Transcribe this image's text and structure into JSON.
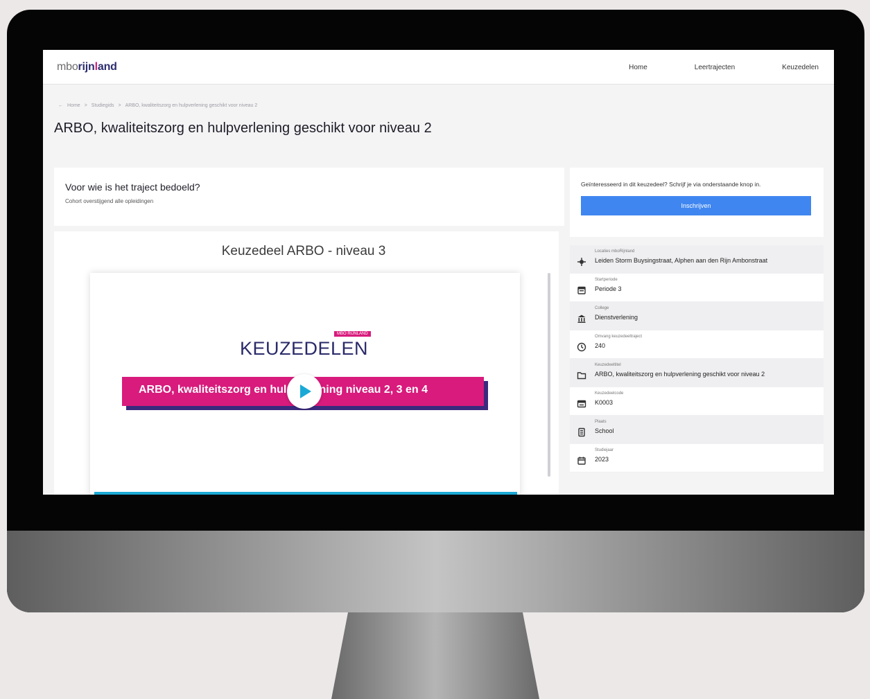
{
  "header": {
    "logo_prefix": "mbo",
    "logo_main": "rijn",
    "logo_accent": "l",
    "logo_suffix": "and",
    "nav": [
      "Home",
      "Leertrajecten",
      "Keuzedelen"
    ]
  },
  "breadcrumb": [
    "←",
    "Home",
    ">",
    "Studiegids",
    ">",
    "ARBO, kwaliteitszorg en hulpverlening geschikt voor niveau 2"
  ],
  "page_title": "ARBO, kwaliteitszorg en hulpverlening geschikt voor niveau 2",
  "who": {
    "heading": "Voor wie is het traject bedoeld?",
    "text": "Cohort overstijgend alle opleidingen"
  },
  "video": {
    "heading": "Keuzedeel ARBO - niveau 3",
    "logo_text": "KEUZEDELEN",
    "logo_tag": "MBO RIJNLAND",
    "banner_text": "ARBO, kwaliteitszorg en hulpverlening niveau 2, 3 en 4"
  },
  "signup": {
    "text": "Geïnteresseerd in dit keuzedeel? Schrijf je via onderstaande knop in.",
    "button": "Inschrijven"
  },
  "details": [
    {
      "icon": "location-icon",
      "label": "Locaties mboRijnland",
      "value": "Leiden Storm Buysingstraat, Alphen aan den Rijn Ambonstraat"
    },
    {
      "icon": "calendar-icon",
      "label": "Startperiode",
      "value": "Periode 3"
    },
    {
      "icon": "building-icon",
      "label": "College",
      "value": "Dienstverlening"
    },
    {
      "icon": "clock-icon",
      "label": "Omvang keuzedeeltraject",
      "value": "240"
    },
    {
      "icon": "folder-icon",
      "label": "Keuzedeeltitel",
      "value": "ARBO, kwaliteitszorg en hulpverlening geschikt voor niveau 2"
    },
    {
      "icon": "code-icon",
      "label": "Keuzedeelcode",
      "value": "K0003"
    },
    {
      "icon": "place-icon",
      "label": "Plaats",
      "value": "School"
    },
    {
      "icon": "year-icon",
      "label": "Studiejaar",
      "value": "2023"
    }
  ],
  "colors": {
    "accent": "#d81b7c",
    "brand": "#2c2c6e",
    "button": "#3f86f0",
    "video_accent": "#1aa9d6"
  }
}
